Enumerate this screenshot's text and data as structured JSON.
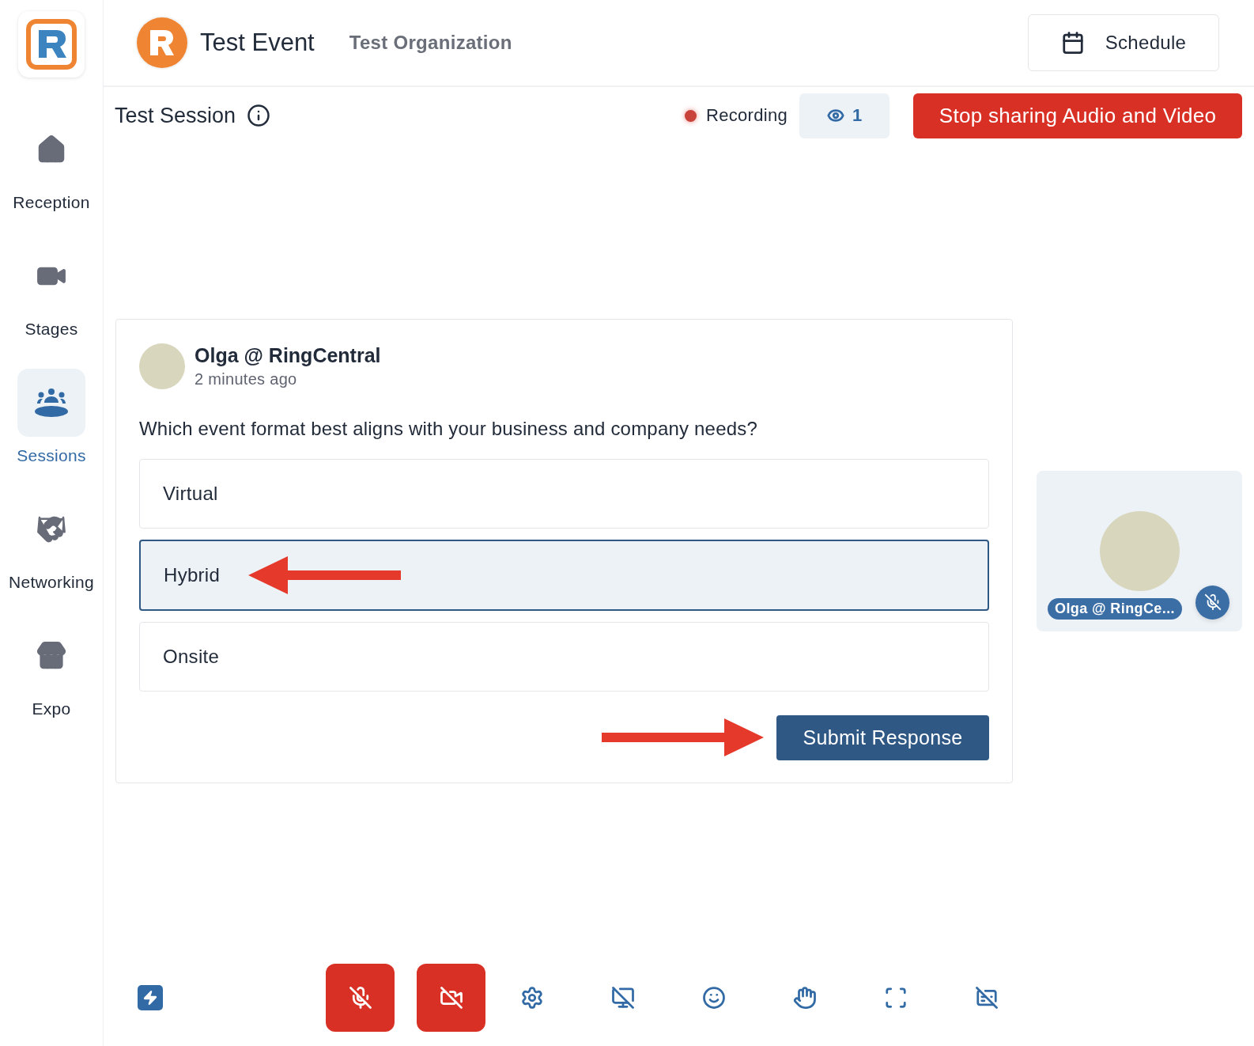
{
  "sidebar": {
    "items": [
      {
        "kind": "reception",
        "label": "Reception",
        "selected": false
      },
      {
        "kind": "stages",
        "label": "Stages",
        "selected": false
      },
      {
        "kind": "sessions",
        "label": "Sessions",
        "selected": true
      },
      {
        "kind": "networking",
        "label": "Networking",
        "selected": false
      },
      {
        "kind": "expo",
        "label": "Expo",
        "selected": false
      }
    ]
  },
  "header": {
    "event_title": "Test Event",
    "organization": "Test Organization",
    "schedule_button": "Schedule"
  },
  "session": {
    "title": "Test Session",
    "recording": "Recording",
    "viewers": "1",
    "stop_button": "Stop sharing Audio and Video"
  },
  "poll": {
    "author": "Olga @ RingCentral",
    "time": "2 minutes ago",
    "question": "Which event format best aligns with your business and company needs?",
    "options": [
      {
        "label": "Virtual",
        "selected": false,
        "arrow": false
      },
      {
        "label": "Hybrid",
        "selected": true,
        "arrow": true
      }
    ],
    "options_rest": [
      {
        "label": "Onsite",
        "selected": false,
        "arrow": false
      }
    ],
    "submit_button": "Submit Response",
    "submit_arrow": true
  },
  "participant": {
    "name": "Olga @ RingCe...",
    "muted": true
  },
  "toolbar": {
    "media": [
      {
        "kind": "microphone",
        "off": true
      },
      {
        "kind": "camera",
        "off": true
      }
    ],
    "tools": [
      {
        "kind": "settings"
      },
      {
        "kind": "screen-share"
      },
      {
        "kind": "reactions"
      },
      {
        "kind": "raise-hand"
      },
      {
        "kind": "fullscreen"
      },
      {
        "kind": "captions"
      }
    ]
  }
}
